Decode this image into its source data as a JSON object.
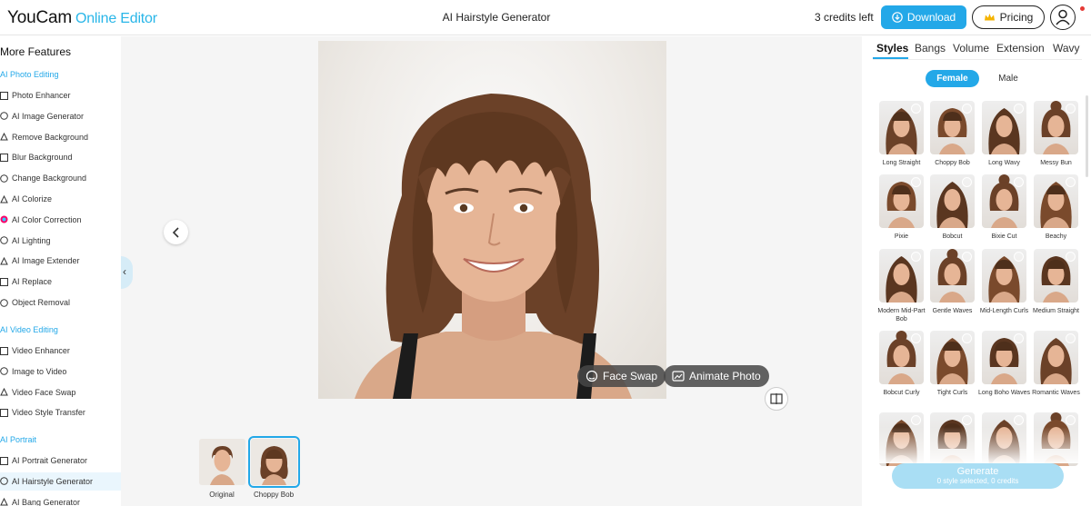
{
  "header": {
    "logo_brand": "YouCam",
    "logo_sub": "Online Editor",
    "page_title": "AI Hairstyle Generator",
    "credits": "3 credits left",
    "download_label": "Download",
    "pricing_label": "Pricing"
  },
  "sidebar": {
    "title": "More Features",
    "sections": [
      {
        "label": "AI Photo Editing",
        "items": [
          "Photo Enhancer",
          "AI Image Generator",
          "Remove Background",
          "Blur Background",
          "Change Background",
          "AI Colorize",
          "AI Color Correction",
          "AI Lighting",
          "AI Image Extender",
          "AI Replace",
          "Object Removal"
        ]
      },
      {
        "label": "AI Video Editing",
        "items": [
          "Video Enhancer",
          "Image to Video",
          "Video Face Swap",
          "Video Style Transfer"
        ]
      },
      {
        "label": "AI Portrait",
        "items": [
          "AI Portrait Generator",
          "AI Hairstyle Generator",
          "AI Bang Generator"
        ]
      }
    ],
    "active_item": "AI Hairstyle Generator"
  },
  "canvas": {
    "face_swap_label": "Face Swap",
    "animate_photo_label": "Animate Photo",
    "thumbnails": [
      {
        "label": "Original",
        "selected": false
      },
      {
        "label": "Choppy Bob",
        "selected": true
      }
    ]
  },
  "right_panel": {
    "tabs": [
      "Styles",
      "Bangs",
      "Volume",
      "Extension",
      "Wavy"
    ],
    "active_tab": "Styles",
    "gender": [
      "Female",
      "Male"
    ],
    "active_gender": "Female",
    "styles": [
      [
        "Long Straight",
        "Choppy Bob",
        "Long Wavy",
        "Messy Bun"
      ],
      [
        "Pixie",
        "Bobcut",
        "Bixie Cut",
        "Beachy"
      ],
      [
        "Modern Mid-Part Bob",
        "Gentle Waves",
        "Mid-Length Curls",
        "Medium Straight"
      ],
      [
        "Bobcut Curly",
        "Tight Curls",
        "Long Boho Waves",
        "Romantic Waves"
      ],
      [
        "",
        "",
        "",
        ""
      ]
    ],
    "generate_label": "Generate",
    "generate_sub": "0 style selected, 0 credits"
  },
  "colors": {
    "accent": "#23a8e8",
    "accent_light": "#a9def4",
    "hair_brown": "#6b4128"
  }
}
